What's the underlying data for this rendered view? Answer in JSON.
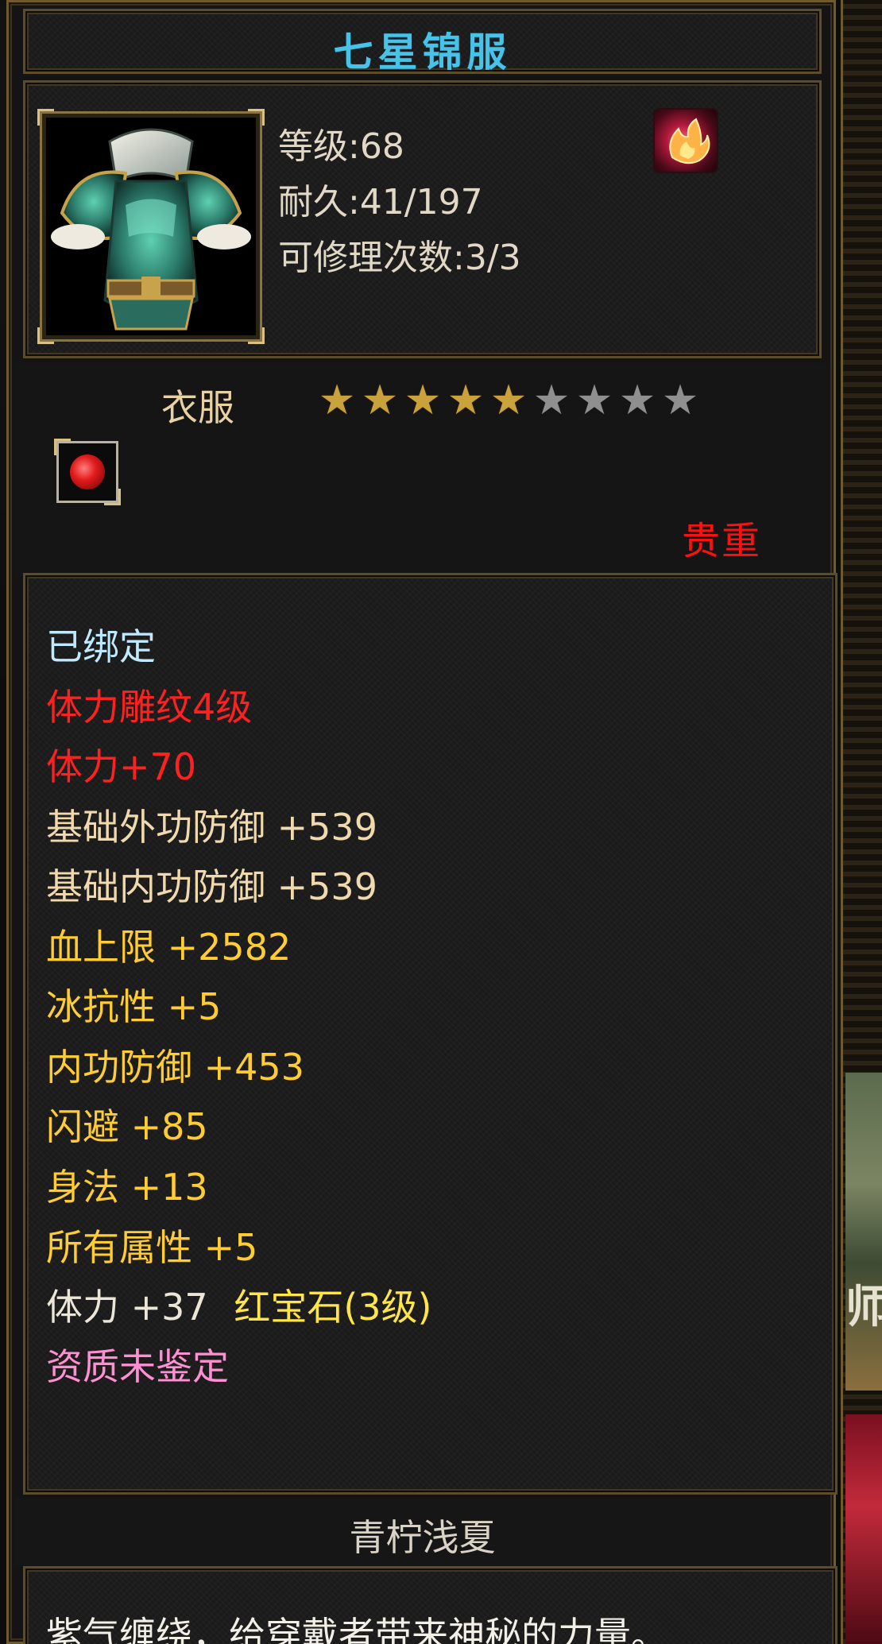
{
  "item": {
    "title": "七星锦服",
    "stats": {
      "level": "等级:68",
      "durability": "耐久:41/197",
      "repair": "可修理次数:3/3"
    },
    "type": "衣服",
    "stars_total": 9,
    "stars_lit": 5,
    "rarity": "贵重",
    "attributes": [
      {
        "text": "已绑定",
        "color": "cyan"
      },
      {
        "text": "体力雕纹4级",
        "color": "red"
      },
      {
        "text": "体力+70",
        "color": "red"
      },
      {
        "text": "基础外功防御 +539",
        "color": "beige"
      },
      {
        "text": "基础内功防御 +539",
        "color": "beige"
      },
      {
        "text": "血上限 +2582",
        "color": "yellow"
      },
      {
        "text": "冰抗性 +5",
        "color": "yellow"
      },
      {
        "text": "内功防御 +453",
        "color": "yellow"
      },
      {
        "text": "闪避 +85",
        "color": "yellow"
      },
      {
        "text": "身法 +13",
        "color": "yellow"
      },
      {
        "text": "所有属性 +5",
        "color": "yellow"
      }
    ],
    "gem_line": {
      "stat": "体力 +37",
      "gem": "红宝石(3级)"
    },
    "aptitude": "资质未鉴定",
    "name": "青柠浅夏",
    "description": "紫气缠绕，给穿戴者带来神秘的力量。"
  },
  "background_glyph": "师",
  "icons": {
    "item_icon": "armor-icon",
    "badge": "flame-badge-icon",
    "gem_slot": "ruby-gem-icon",
    "star": "star-icon"
  },
  "colors": {
    "title": "#49c2e8",
    "rarity": "#ff1010",
    "star_lit": "#c9a23c",
    "star_dim": "#8f8f8f",
    "frame": "#6e5a2c"
  }
}
